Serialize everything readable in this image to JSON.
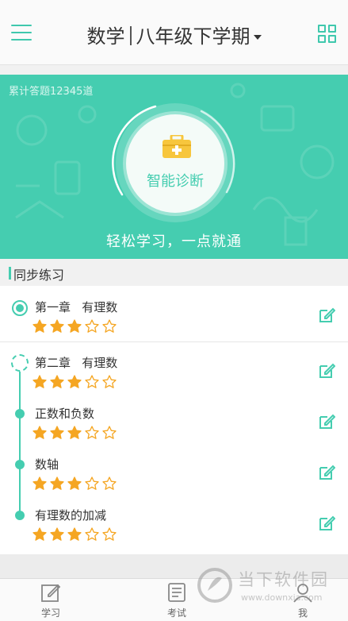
{
  "header": {
    "subject": "数学",
    "grade": "八年级下学期",
    "menu_icon": "hamburger-menu-icon",
    "grid_icon": "grid-apps-icon"
  },
  "banner": {
    "total_answered": "累计答题12345道",
    "diagnose_label": "智能诊断",
    "slogan": "轻松学习，一点就通",
    "diagnose_icon": "medical-kit-icon"
  },
  "section": {
    "label": "同步练习"
  },
  "chapters": [
    {
      "title": "第一章   有理数",
      "stars": 3,
      "max_stars": 5
    },
    {
      "title": "第二章   有理数",
      "stars": 3,
      "max_stars": 5
    },
    {
      "title": "正数和负数",
      "stars": 3,
      "max_stars": 5
    },
    {
      "title": "数轴",
      "stars": 3,
      "max_stars": 5
    },
    {
      "title": "有理数的加减",
      "stars": 3,
      "max_stars": 5
    }
  ],
  "nav": {
    "items": [
      {
        "label": "学习",
        "icon": "pencil-square-icon"
      },
      {
        "label": "考试",
        "icon": "exam-list-icon"
      },
      {
        "label": "我",
        "icon": "person-icon"
      }
    ]
  },
  "watermark": {
    "brand": "当下软件园",
    "url": "www.downxia.com"
  },
  "colors": {
    "accent": "#45cdb0",
    "star": "#f5a623",
    "text": "#333333"
  }
}
